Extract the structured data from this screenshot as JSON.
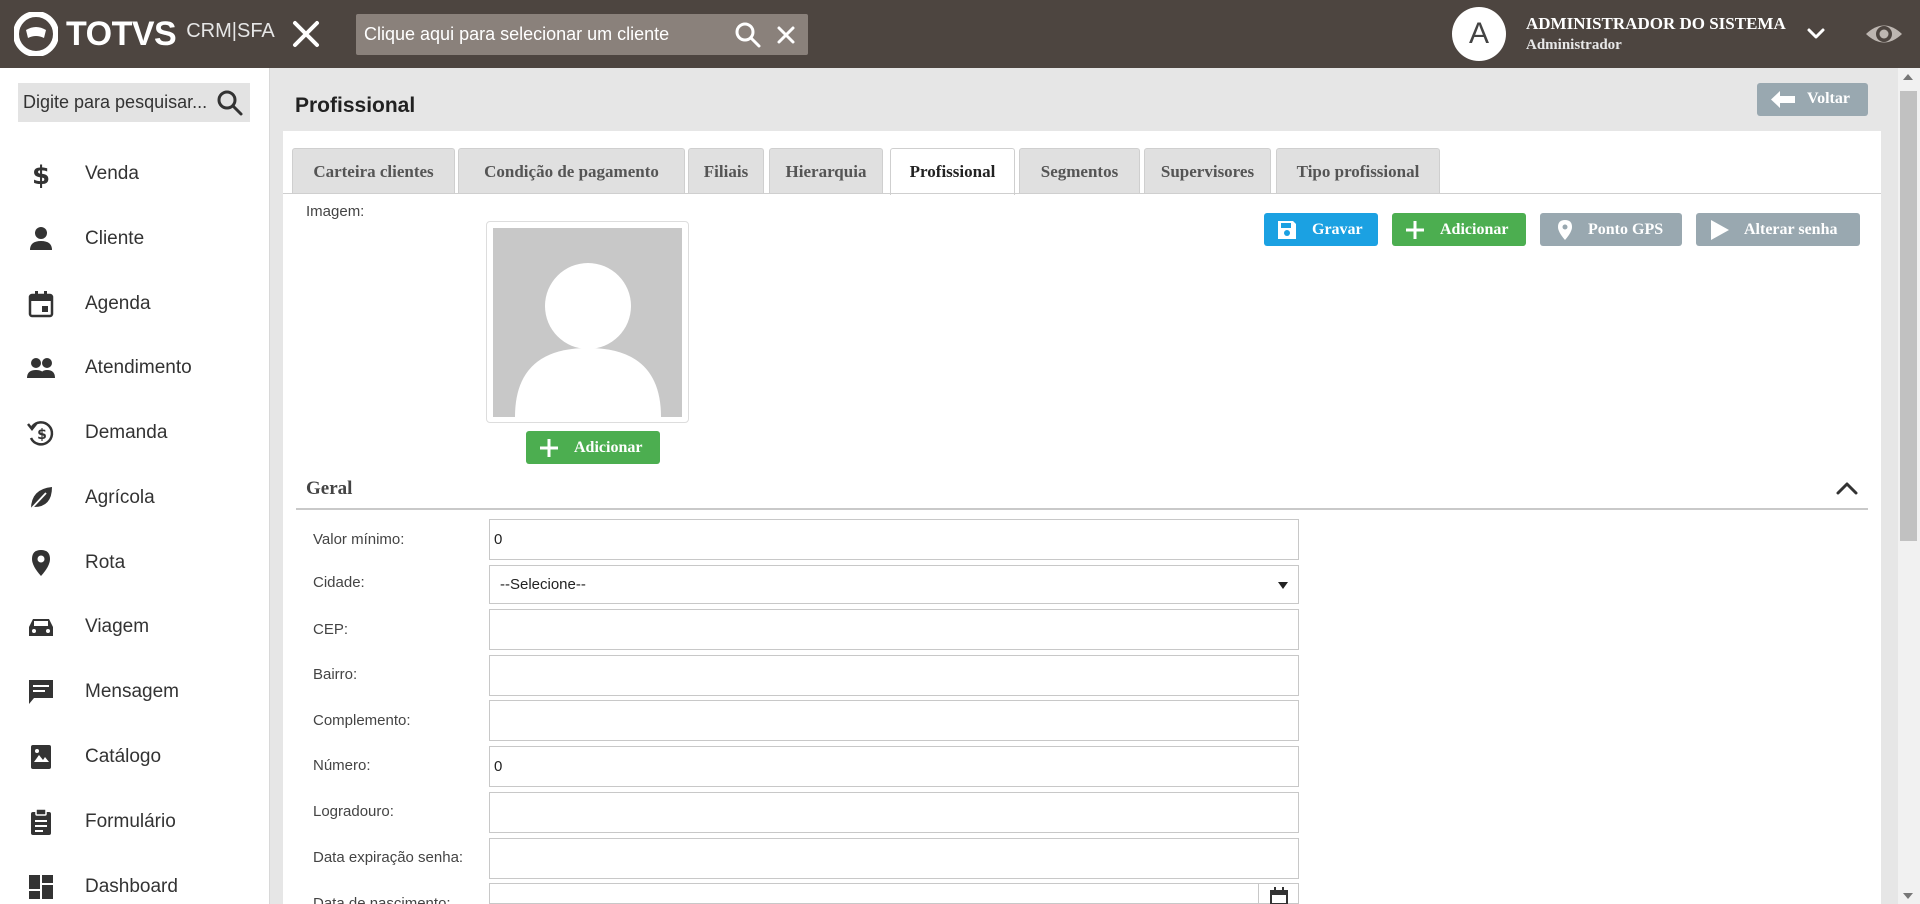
{
  "brand": {
    "name": "TOTVS",
    "product": "CRM|SFA"
  },
  "header": {
    "client_search_placeholder": "Clique aqui para selecionar um cliente",
    "user_initial": "A",
    "user_name": "ADMINISTRADOR DO SISTEMA",
    "user_role": "Administrador"
  },
  "sidebar": {
    "search_placeholder": "Digite para pesquisar...",
    "items": [
      {
        "label": "Venda",
        "icon": "dollar-icon"
      },
      {
        "label": "Cliente",
        "icon": "person-icon"
      },
      {
        "label": "Agenda",
        "icon": "calendar-icon"
      },
      {
        "label": "Atendimento",
        "icon": "people-icon"
      },
      {
        "label": "Demanda",
        "icon": "money-history-icon"
      },
      {
        "label": "Agrícola",
        "icon": "leaf-icon"
      },
      {
        "label": "Rota",
        "icon": "map-pin-icon"
      },
      {
        "label": "Viagem",
        "icon": "car-icon"
      },
      {
        "label": "Mensagem",
        "icon": "message-icon"
      },
      {
        "label": "Catálogo",
        "icon": "book-image-icon"
      },
      {
        "label": "Formulário",
        "icon": "clipboard-icon"
      },
      {
        "label": "Dashboard",
        "icon": "dashboard-icon"
      }
    ]
  },
  "main": {
    "title": "Profissional",
    "back_label": "Voltar",
    "tabs": [
      {
        "label": "Carteira clientes"
      },
      {
        "label": "Condição de pagamento"
      },
      {
        "label": "Filiais"
      },
      {
        "label": "Hierarquia"
      },
      {
        "label": "Profissional",
        "active": true
      },
      {
        "label": "Segmentos"
      },
      {
        "label": "Supervisores"
      },
      {
        "label": "Tipo profissional"
      }
    ],
    "image_label": "Imagem:",
    "image_add_label": "Adicionar",
    "actions": {
      "save": "Gravar",
      "add": "Adicionar",
      "gps": "Ponto GPS",
      "change_password": "Alterar senha"
    },
    "section_title": "Geral",
    "fields": [
      {
        "label": "Valor mínimo:",
        "value": "0"
      },
      {
        "label": "Cidade:",
        "value": "--Selecione--",
        "type": "select"
      },
      {
        "label": "CEP:",
        "value": ""
      },
      {
        "label": "Bairro:",
        "value": ""
      },
      {
        "label": "Complemento:",
        "value": ""
      },
      {
        "label": "Número:",
        "value": "0"
      },
      {
        "label": "Logradouro:",
        "value": ""
      },
      {
        "label": "Data expiração senha:",
        "value": ""
      },
      {
        "label": "Data de nascimento:",
        "value": "",
        "type": "date"
      }
    ]
  },
  "colors": {
    "topbar": "#4d4540",
    "green": "#4cae50",
    "blue": "#1ba1e2",
    "grey_button": "#99a8b0"
  }
}
